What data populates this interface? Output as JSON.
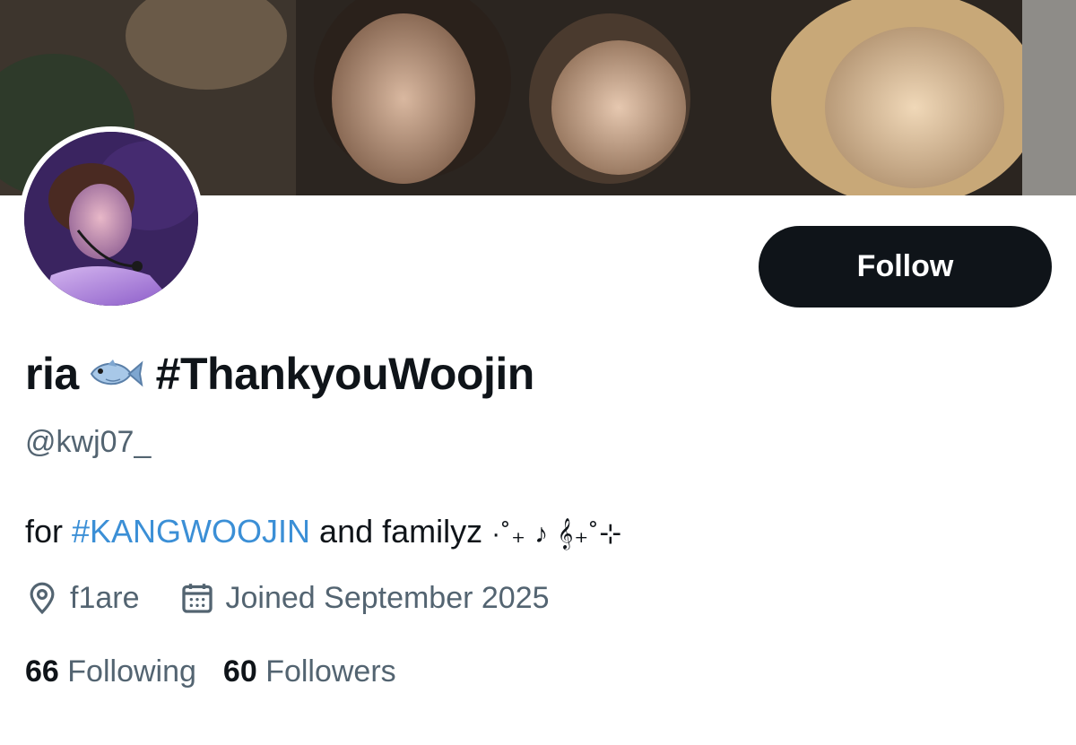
{
  "profile": {
    "display_name": "ria",
    "display_name_emoji": "fish-icon",
    "display_name_hashtag": "#ThankyouWoojin",
    "handle": "@kwj07_",
    "bio": {
      "prefix": "for ",
      "hashtag": "#KANGWOOJIN",
      "suffix": " and familyz ",
      "decoration": "·˚₊ ♪ 𝄞₊˚⊹"
    },
    "location": "f1are",
    "joined": "Joined September 2025",
    "following_count": "66",
    "following_label": "Following",
    "followers_count": "60",
    "followers_label": "Followers"
  },
  "actions": {
    "follow_label": "Follow"
  },
  "colors": {
    "text_primary": "#0f1419",
    "text_secondary": "#536471",
    "link": "#3b8fd6",
    "button_bg": "#0f1419",
    "button_text": "#ffffff"
  },
  "icons": {
    "location": "location-pin-icon",
    "joined": "calendar-icon"
  }
}
